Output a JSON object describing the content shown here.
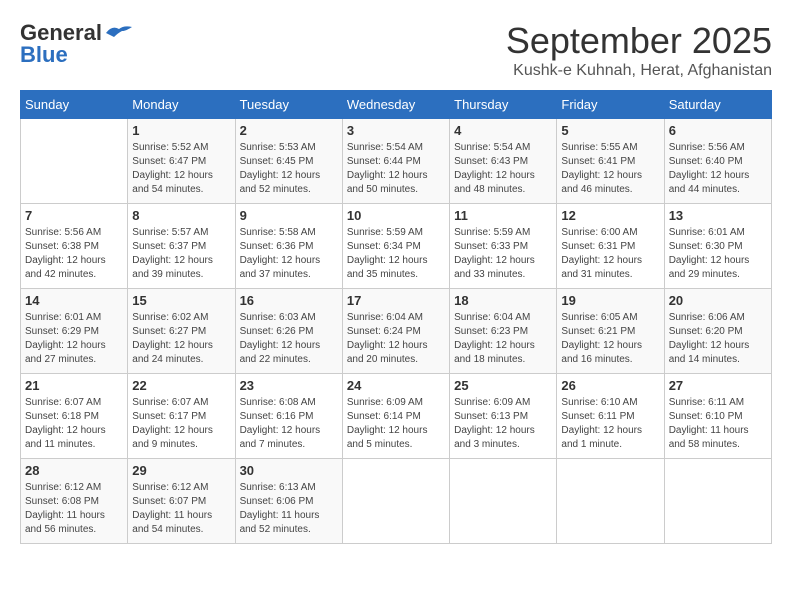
{
  "header": {
    "logo_general": "General",
    "logo_blue": "Blue",
    "month_title": "September 2025",
    "location": "Kushk-e Kuhnah, Herat, Afghanistan"
  },
  "weekdays": [
    "Sunday",
    "Monday",
    "Tuesday",
    "Wednesday",
    "Thursday",
    "Friday",
    "Saturday"
  ],
  "weeks": [
    [
      {
        "day": "",
        "sunrise": "",
        "sunset": "",
        "daylight": ""
      },
      {
        "day": "1",
        "sunrise": "Sunrise: 5:52 AM",
        "sunset": "Sunset: 6:47 PM",
        "daylight": "Daylight: 12 hours and 54 minutes."
      },
      {
        "day": "2",
        "sunrise": "Sunrise: 5:53 AM",
        "sunset": "Sunset: 6:45 PM",
        "daylight": "Daylight: 12 hours and 52 minutes."
      },
      {
        "day": "3",
        "sunrise": "Sunrise: 5:54 AM",
        "sunset": "Sunset: 6:44 PM",
        "daylight": "Daylight: 12 hours and 50 minutes."
      },
      {
        "day": "4",
        "sunrise": "Sunrise: 5:54 AM",
        "sunset": "Sunset: 6:43 PM",
        "daylight": "Daylight: 12 hours and 48 minutes."
      },
      {
        "day": "5",
        "sunrise": "Sunrise: 5:55 AM",
        "sunset": "Sunset: 6:41 PM",
        "daylight": "Daylight: 12 hours and 46 minutes."
      },
      {
        "day": "6",
        "sunrise": "Sunrise: 5:56 AM",
        "sunset": "Sunset: 6:40 PM",
        "daylight": "Daylight: 12 hours and 44 minutes."
      }
    ],
    [
      {
        "day": "7",
        "sunrise": "Sunrise: 5:56 AM",
        "sunset": "Sunset: 6:38 PM",
        "daylight": "Daylight: 12 hours and 42 minutes."
      },
      {
        "day": "8",
        "sunrise": "Sunrise: 5:57 AM",
        "sunset": "Sunset: 6:37 PM",
        "daylight": "Daylight: 12 hours and 39 minutes."
      },
      {
        "day": "9",
        "sunrise": "Sunrise: 5:58 AM",
        "sunset": "Sunset: 6:36 PM",
        "daylight": "Daylight: 12 hours and 37 minutes."
      },
      {
        "day": "10",
        "sunrise": "Sunrise: 5:59 AM",
        "sunset": "Sunset: 6:34 PM",
        "daylight": "Daylight: 12 hours and 35 minutes."
      },
      {
        "day": "11",
        "sunrise": "Sunrise: 5:59 AM",
        "sunset": "Sunset: 6:33 PM",
        "daylight": "Daylight: 12 hours and 33 minutes."
      },
      {
        "day": "12",
        "sunrise": "Sunrise: 6:00 AM",
        "sunset": "Sunset: 6:31 PM",
        "daylight": "Daylight: 12 hours and 31 minutes."
      },
      {
        "day": "13",
        "sunrise": "Sunrise: 6:01 AM",
        "sunset": "Sunset: 6:30 PM",
        "daylight": "Daylight: 12 hours and 29 minutes."
      }
    ],
    [
      {
        "day": "14",
        "sunrise": "Sunrise: 6:01 AM",
        "sunset": "Sunset: 6:29 PM",
        "daylight": "Daylight: 12 hours and 27 minutes."
      },
      {
        "day": "15",
        "sunrise": "Sunrise: 6:02 AM",
        "sunset": "Sunset: 6:27 PM",
        "daylight": "Daylight: 12 hours and 24 minutes."
      },
      {
        "day": "16",
        "sunrise": "Sunrise: 6:03 AM",
        "sunset": "Sunset: 6:26 PM",
        "daylight": "Daylight: 12 hours and 22 minutes."
      },
      {
        "day": "17",
        "sunrise": "Sunrise: 6:04 AM",
        "sunset": "Sunset: 6:24 PM",
        "daylight": "Daylight: 12 hours and 20 minutes."
      },
      {
        "day": "18",
        "sunrise": "Sunrise: 6:04 AM",
        "sunset": "Sunset: 6:23 PM",
        "daylight": "Daylight: 12 hours and 18 minutes."
      },
      {
        "day": "19",
        "sunrise": "Sunrise: 6:05 AM",
        "sunset": "Sunset: 6:21 PM",
        "daylight": "Daylight: 12 hours and 16 minutes."
      },
      {
        "day": "20",
        "sunrise": "Sunrise: 6:06 AM",
        "sunset": "Sunset: 6:20 PM",
        "daylight": "Daylight: 12 hours and 14 minutes."
      }
    ],
    [
      {
        "day": "21",
        "sunrise": "Sunrise: 6:07 AM",
        "sunset": "Sunset: 6:18 PM",
        "daylight": "Daylight: 12 hours and 11 minutes."
      },
      {
        "day": "22",
        "sunrise": "Sunrise: 6:07 AM",
        "sunset": "Sunset: 6:17 PM",
        "daylight": "Daylight: 12 hours and 9 minutes."
      },
      {
        "day": "23",
        "sunrise": "Sunrise: 6:08 AM",
        "sunset": "Sunset: 6:16 PM",
        "daylight": "Daylight: 12 hours and 7 minutes."
      },
      {
        "day": "24",
        "sunrise": "Sunrise: 6:09 AM",
        "sunset": "Sunset: 6:14 PM",
        "daylight": "Daylight: 12 hours and 5 minutes."
      },
      {
        "day": "25",
        "sunrise": "Sunrise: 6:09 AM",
        "sunset": "Sunset: 6:13 PM",
        "daylight": "Daylight: 12 hours and 3 minutes."
      },
      {
        "day": "26",
        "sunrise": "Sunrise: 6:10 AM",
        "sunset": "Sunset: 6:11 PM",
        "daylight": "Daylight: 12 hours and 1 minute."
      },
      {
        "day": "27",
        "sunrise": "Sunrise: 6:11 AM",
        "sunset": "Sunset: 6:10 PM",
        "daylight": "Daylight: 11 hours and 58 minutes."
      }
    ],
    [
      {
        "day": "28",
        "sunrise": "Sunrise: 6:12 AM",
        "sunset": "Sunset: 6:08 PM",
        "daylight": "Daylight: 11 hours and 56 minutes."
      },
      {
        "day": "29",
        "sunrise": "Sunrise: 6:12 AM",
        "sunset": "Sunset: 6:07 PM",
        "daylight": "Daylight: 11 hours and 54 minutes."
      },
      {
        "day": "30",
        "sunrise": "Sunrise: 6:13 AM",
        "sunset": "Sunset: 6:06 PM",
        "daylight": "Daylight: 11 hours and 52 minutes."
      },
      {
        "day": "",
        "sunrise": "",
        "sunset": "",
        "daylight": ""
      },
      {
        "day": "",
        "sunrise": "",
        "sunset": "",
        "daylight": ""
      },
      {
        "day": "",
        "sunrise": "",
        "sunset": "",
        "daylight": ""
      },
      {
        "day": "",
        "sunrise": "",
        "sunset": "",
        "daylight": ""
      }
    ]
  ]
}
